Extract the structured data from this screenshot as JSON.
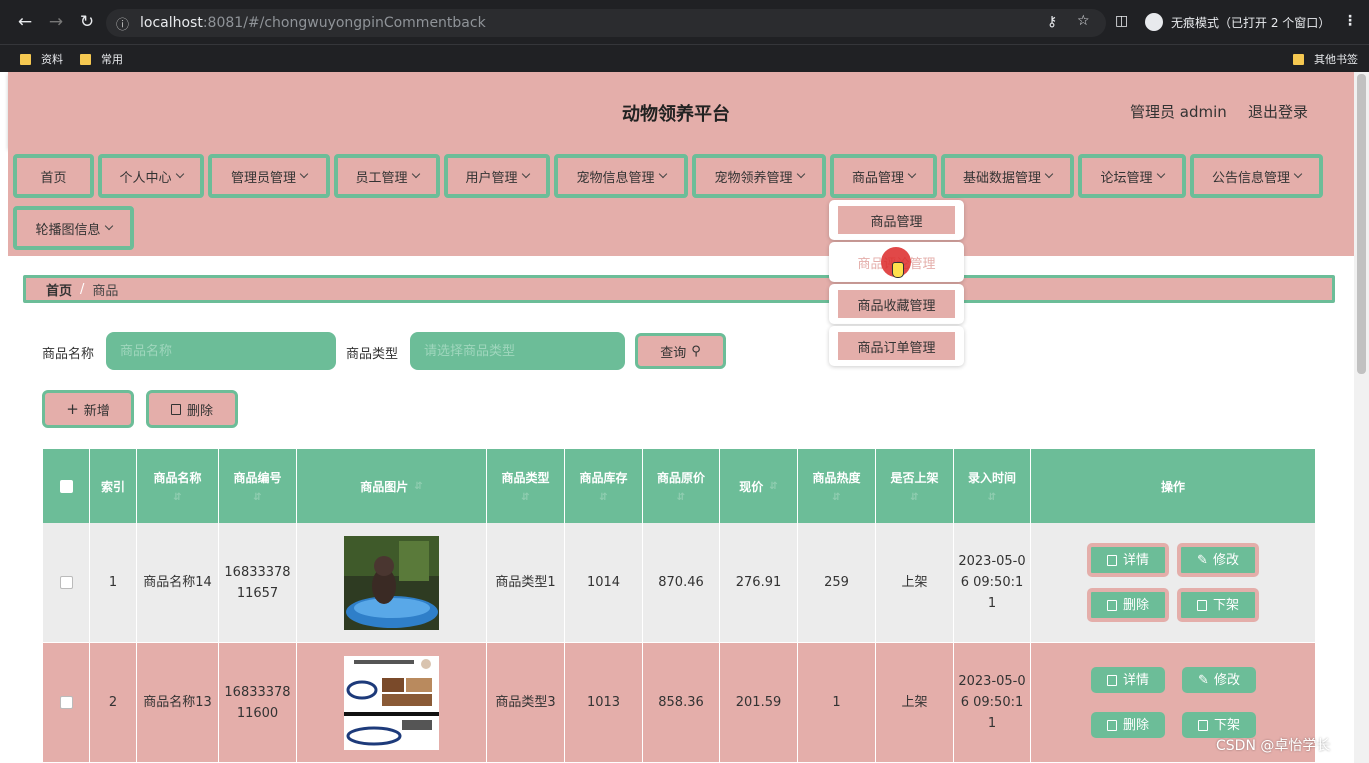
{
  "browser": {
    "url_host": "localhost",
    "url_rest": ":8081/#/chongwuyongpinCommentback",
    "incognito_label": "无痕模式（已打开 2 个窗口）",
    "bookmarks": [
      "资料",
      "常用"
    ],
    "other_bookmarks": "其他书签"
  },
  "header": {
    "title": "动物领养平台",
    "user": "管理员 admin",
    "logout": "退出登录"
  },
  "nav": {
    "items": [
      "首页",
      "个人中心",
      "管理员管理",
      "员工管理",
      "用户管理",
      "宠物信息管理",
      "宠物领养管理",
      "商品管理",
      "基础数据管理",
      "论坛管理",
      "公告信息管理",
      "轮播图信息"
    ],
    "dropdown": [
      "商品管理",
      "商品评论管理",
      "商品收藏管理",
      "商品订单管理"
    ]
  },
  "breadcrumb": {
    "home": "首页",
    "sep": "/",
    "current": "商品"
  },
  "search": {
    "name_label": "商品名称",
    "name_placeholder": "商品名称",
    "type_label": "商品类型",
    "type_placeholder": "请选择商品类型",
    "query_button": "查询"
  },
  "actions": {
    "add": "新增",
    "delete": "删除"
  },
  "table": {
    "headers": [
      "索引",
      "商品名称",
      "商品编号",
      "商品图片",
      "商品类型",
      "商品库存",
      "商品原价",
      "现价",
      "商品热度",
      "是否上架",
      "录入时间",
      "操作"
    ],
    "rows": [
      {
        "index": "1",
        "name": "商品名称14",
        "code": "1683337811657",
        "type": "商品类型1",
        "stock": "1014",
        "orig": "870.46",
        "price": "276.91",
        "hot": "259",
        "shelf": "上架",
        "time": "2023-05-06 09:50:11"
      },
      {
        "index": "2",
        "name": "商品名称13",
        "code": "1683337811600",
        "type": "商品类型3",
        "stock": "1013",
        "orig": "858.36",
        "price": "201.59",
        "hot": "1",
        "shelf": "上架",
        "time": "2023-05-06 09:50:11"
      }
    ],
    "ops": [
      "详情",
      "修改",
      "删除",
      "下架"
    ]
  },
  "watermark": "CSDN @卓怡学长",
  "colors": {
    "pink": "#e4aeaa",
    "green": "#6cbd98"
  }
}
